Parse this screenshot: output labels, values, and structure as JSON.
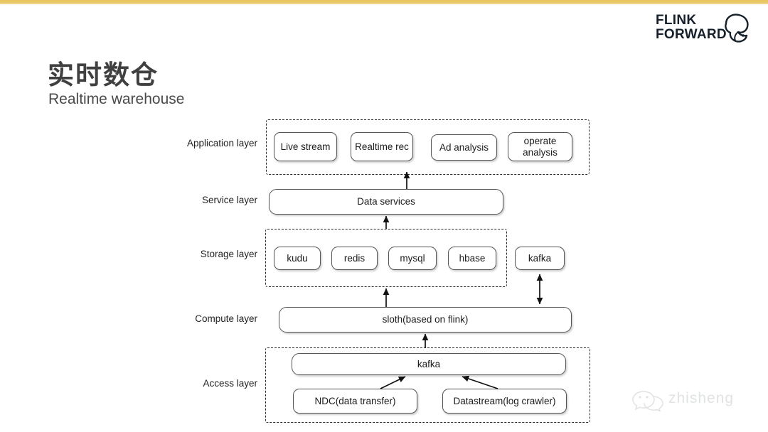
{
  "slide": {
    "title_cn": "实时数仓",
    "title_en": "Realtime warehouse",
    "accent_color": "#e9c45c",
    "box_border_color": "#555555",
    "dashed_color": "#2b2b2b"
  },
  "logo": {
    "line1": "FLINK",
    "line2": "FORWARD",
    "icon": "squirrel-icon",
    "color": "#15202b"
  },
  "layers": [
    {
      "label": "Application layer"
    },
    {
      "label": "Service layer"
    },
    {
      "label": "Storage layer"
    },
    {
      "label": "Compute layer"
    },
    {
      "label": "Access layer"
    }
  ],
  "application_layer": {
    "nodes": [
      {
        "label": "Live stream"
      },
      {
        "label": "Realtime rec"
      },
      {
        "label": "Ad analysis"
      },
      {
        "label": "operate analysis"
      }
    ]
  },
  "service_layer": {
    "nodes": [
      {
        "label": "Data services"
      }
    ]
  },
  "storage_layer": {
    "grouped_nodes": [
      {
        "label": "kudu"
      },
      {
        "label": "redis"
      },
      {
        "label": "mysql"
      },
      {
        "label": "hbase"
      }
    ],
    "external_nodes": [
      {
        "label": "kafka"
      }
    ]
  },
  "compute_layer": {
    "nodes": [
      {
        "label": "sloth(based on flink)"
      }
    ]
  },
  "access_layer": {
    "nodes": [
      {
        "label": "kafka"
      },
      {
        "label": "NDC(data transfer)"
      },
      {
        "label": "Datastream(log crawler)"
      }
    ]
  },
  "watermark": {
    "text": "zhisheng",
    "icon": "wechat-icon"
  }
}
